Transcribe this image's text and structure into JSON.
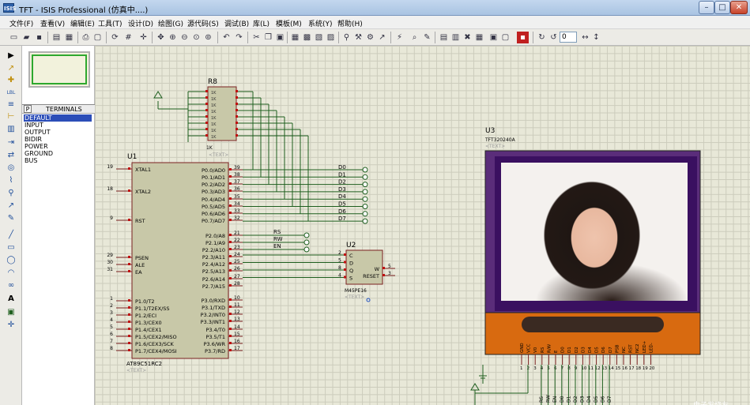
{
  "window": {
    "title": "TFT - ISIS Professional (仿真中....)",
    "icon_text": "ISIS",
    "buttons": [
      "–",
      "□",
      "✕"
    ]
  },
  "menu": [
    "文件(F)",
    "查看(V)",
    "编辑(E)",
    "工具(T)",
    "设计(D)",
    "绘图(G)",
    "源代码(S)",
    "调试(B)",
    "库(L)",
    "模板(M)",
    "系统(Y)",
    "帮助(H)"
  ],
  "toolbar": {
    "field_value": "0",
    "icons": [
      "new-icon",
      "open-icon",
      "save-icon",
      "import-icon",
      "export-icon",
      "print-icon",
      "area-icon",
      "refresh-icon",
      "grid-icon",
      "origin-icon",
      "pan-icon",
      "zoom-in-icon",
      "zoom-out-icon",
      "zoom-all-icon",
      "zoom-area-icon",
      "undo-icon",
      "redo-icon",
      "cut-icon",
      "copy-icon",
      "paste-icon",
      "block-copy-icon",
      "block-move-icon",
      "block-rotate-icon",
      "block-delete-icon",
      "pick-icon",
      "make-device-icon",
      "packaging-icon",
      "decompose-icon",
      "wire-autorouter-icon",
      "search-icon",
      "property-icon",
      "netlist-icon",
      "bom-icon",
      "erc-icon",
      "ares-icon",
      "rotate-cw-icon",
      "rotate-ccw-icon",
      "mirror-h-icon",
      "mirror-v-icon"
    ]
  },
  "left_tools": [
    "▶",
    "↗",
    "✚",
    "LBL",
    "≡",
    "⊢",
    "▥",
    "⇥",
    "⇄",
    "◎",
    "⌇",
    "⚲",
    "↗",
    "✎",
    "╱",
    "▭",
    "◯",
    "◠",
    "∞",
    "A",
    "▣",
    "✛"
  ],
  "panel": {
    "mode": "P",
    "title": "TERMINALS",
    "items": [
      "DEFAULT",
      "INPUT",
      "OUTPUT",
      "BIDIR",
      "POWER",
      "GROUND",
      "BUS"
    ],
    "selected": "DEFAULT"
  },
  "schematic": {
    "u1": {
      "ref": "U1",
      "part": "AT89C51RC2",
      "text": "<TEXT>",
      "left_pins": [
        {
          "n": "19",
          "name": "XTAL1"
        },
        {
          "n": "18",
          "name": "XTAL2"
        },
        {
          "n": "9",
          "name": "RST"
        },
        {
          "n": "29",
          "name": "PSEN"
        },
        {
          "n": "30",
          "name": "ALE"
        },
        {
          "n": "31",
          "name": "EA"
        },
        {
          "n": "1",
          "name": "P1.0/T2"
        },
        {
          "n": "2",
          "name": "P1.1/T2EX/SS"
        },
        {
          "n": "3",
          "name": "P1.2/ECI"
        },
        {
          "n": "4",
          "name": "P1.3/CEX0"
        },
        {
          "n": "5",
          "name": "P1.4/CEX1"
        },
        {
          "n": "6",
          "name": "P1.5/CEX2/MISO"
        },
        {
          "n": "7",
          "name": "P1.6/CEX3/SCK"
        },
        {
          "n": "8",
          "name": "P1.7/CEX4/MOSI"
        }
      ],
      "right_pins": [
        {
          "n": "39",
          "name": "P0.0/AD0"
        },
        {
          "n": "38",
          "name": "P0.1/AD1"
        },
        {
          "n": "37",
          "name": "P0.2/AD2"
        },
        {
          "n": "36",
          "name": "P0.3/AD3"
        },
        {
          "n": "35",
          "name": "P0.4/AD4"
        },
        {
          "n": "34",
          "name": "P0.5/AD5"
        },
        {
          "n": "33",
          "name": "P0.6/AD6"
        },
        {
          "n": "32",
          "name": "P0.7/AD7"
        },
        {
          "n": "21",
          "name": "P2.0/A8"
        },
        {
          "n": "22",
          "name": "P2.1/A9"
        },
        {
          "n": "23",
          "name": "P2.2/A10"
        },
        {
          "n": "24",
          "name": "P2.3/A11"
        },
        {
          "n": "25",
          "name": "P2.4/A12"
        },
        {
          "n": "26",
          "name": "P2.5/A13"
        },
        {
          "n": "27",
          "name": "P2.6/A14"
        },
        {
          "n": "28",
          "name": "P2.7/A15"
        },
        {
          "n": "10",
          "name": "P3.0/RXD"
        },
        {
          "n": "11",
          "name": "P3.1/TXD"
        },
        {
          "n": "12",
          "name": "P3.2/INT0"
        },
        {
          "n": "13",
          "name": "P3.3/INT1"
        },
        {
          "n": "14",
          "name": "P3.4/T0"
        },
        {
          "n": "15",
          "name": "P3.5/T1"
        },
        {
          "n": "16",
          "name": "P3.6/WR"
        },
        {
          "n": "17",
          "name": "P3.7/RD"
        }
      ]
    },
    "r8": {
      "ref": "R8",
      "value": "1K",
      "text": "<TEXT>"
    },
    "data_nets": [
      "D0",
      "D1",
      "D2",
      "D3",
      "D4",
      "D5",
      "D6",
      "D7"
    ],
    "ctrl_nets": [
      "RS",
      "RW",
      "EN"
    ],
    "u2": {
      "ref": "U2",
      "part": "M45PE16",
      "text": "<TEXT>",
      "left_pins": [
        {
          "n": "2",
          "name": "C"
        },
        {
          "n": "5",
          "name": "D"
        },
        {
          "n": "8",
          "name": "Q"
        },
        {
          "n": "4",
          "name": "S"
        }
      ],
      "right_pins": [
        {
          "n": "5",
          "name": "W"
        },
        {
          "n": "3",
          "name": "RESET"
        }
      ]
    },
    "u3": {
      "ref": "U3",
      "part": "TFT320240A",
      "text": "<TEXT>",
      "pins": [
        "GND",
        "VCC",
        "V0",
        "RS",
        "R/W",
        "E",
        "D0",
        "D1",
        "D2",
        "D3",
        "D4",
        "D5",
        "D6",
        "D7",
        "PSB",
        "NC",
        "RST",
        "NC2",
        "LED+",
        "LED-"
      ],
      "pin_numbers": [
        "1",
        "2",
        "3",
        "4",
        "5",
        "6",
        "7",
        "8",
        "9",
        "10",
        "11",
        "12",
        "13",
        "14",
        "15",
        "16",
        "17",
        "18",
        "19",
        "20"
      ],
      "bottom_nets": [
        "RS",
        "RW",
        "EN",
        "D0",
        "D1",
        "D2",
        "D3",
        "D4",
        "D5",
        "D6",
        "D7"
      ]
    }
  },
  "colors": {
    "canvas": "#e8e8d8",
    "chip_fill": "#c8c8a8",
    "wire": "#1e5e1e",
    "pin_red": "#c01010",
    "tft_frame": "#3a1060",
    "tft_orange": "#d86a10"
  },
  "footer": {
    "watermark": "电子发烧友"
  }
}
